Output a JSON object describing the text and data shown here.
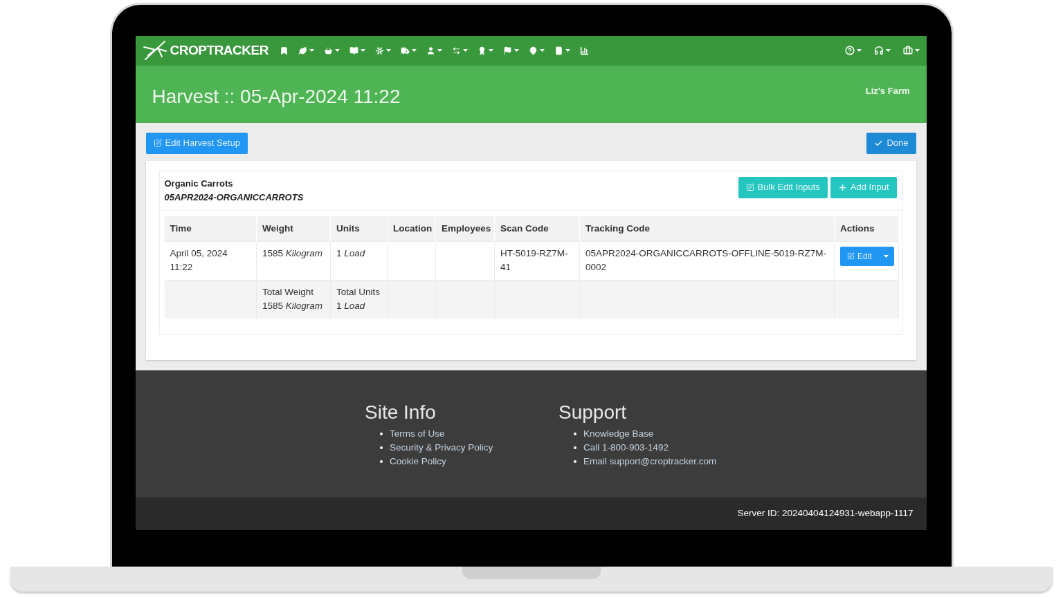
{
  "navbar": {
    "brand": "CROPTRACKER"
  },
  "header": {
    "title": "Harvest :: 05-Apr-2024 11:22",
    "farm": "Liz's Farm"
  },
  "toolbar": {
    "edit_button": "Edit Harvest Setup",
    "done_button": "Done"
  },
  "panel": {
    "product": "Organic Carrots",
    "code": "05APR2024-ORGANICCARROTS",
    "buttons": [
      {
        "label": "Bulk Edit Inputs",
        "kind": "edit"
      },
      {
        "label": "Add Input",
        "kind": "add"
      }
    ]
  },
  "table": {
    "columns": [
      "Time",
      "Weight",
      "Units",
      "Location",
      "Employees",
      "Scan Code",
      "Tracking Code",
      "Actions"
    ],
    "rows": [
      {
        "kind": "entry",
        "cells": [
          [
            "April 05, 2024 11:22"
          ],
          [
            "1585 *Kilogram*"
          ],
          [
            "1 *Load*"
          ],
          [],
          [],
          [
            "HT-5019-RZ7M-41"
          ],
          [
            "05APR2024-ORGANICCARROTS-OFFLINE-5019-RZ7M-0002"
          ],
          []
        ],
        "action": "Edit"
      },
      {
        "kind": "total",
        "cells": [
          [],
          [
            "Total Weight",
            "1585 *Kilogram*"
          ],
          [
            "Total Units",
            "1 *Load*"
          ],
          [],
          [],
          [],
          [],
          []
        ]
      }
    ]
  },
  "footer": {
    "sections": [
      {
        "title": "Site Info",
        "links": [
          "Terms of Use",
          "Security & Privacy Policy",
          "Cookie Policy"
        ]
      },
      {
        "title": "Support",
        "links": [
          "Knowledge Base",
          "Call 1-800-903-1492",
          "Email support@croptracker.com"
        ]
      }
    ],
    "server_id": "Server ID: 20240404124931-webapp-1117"
  }
}
